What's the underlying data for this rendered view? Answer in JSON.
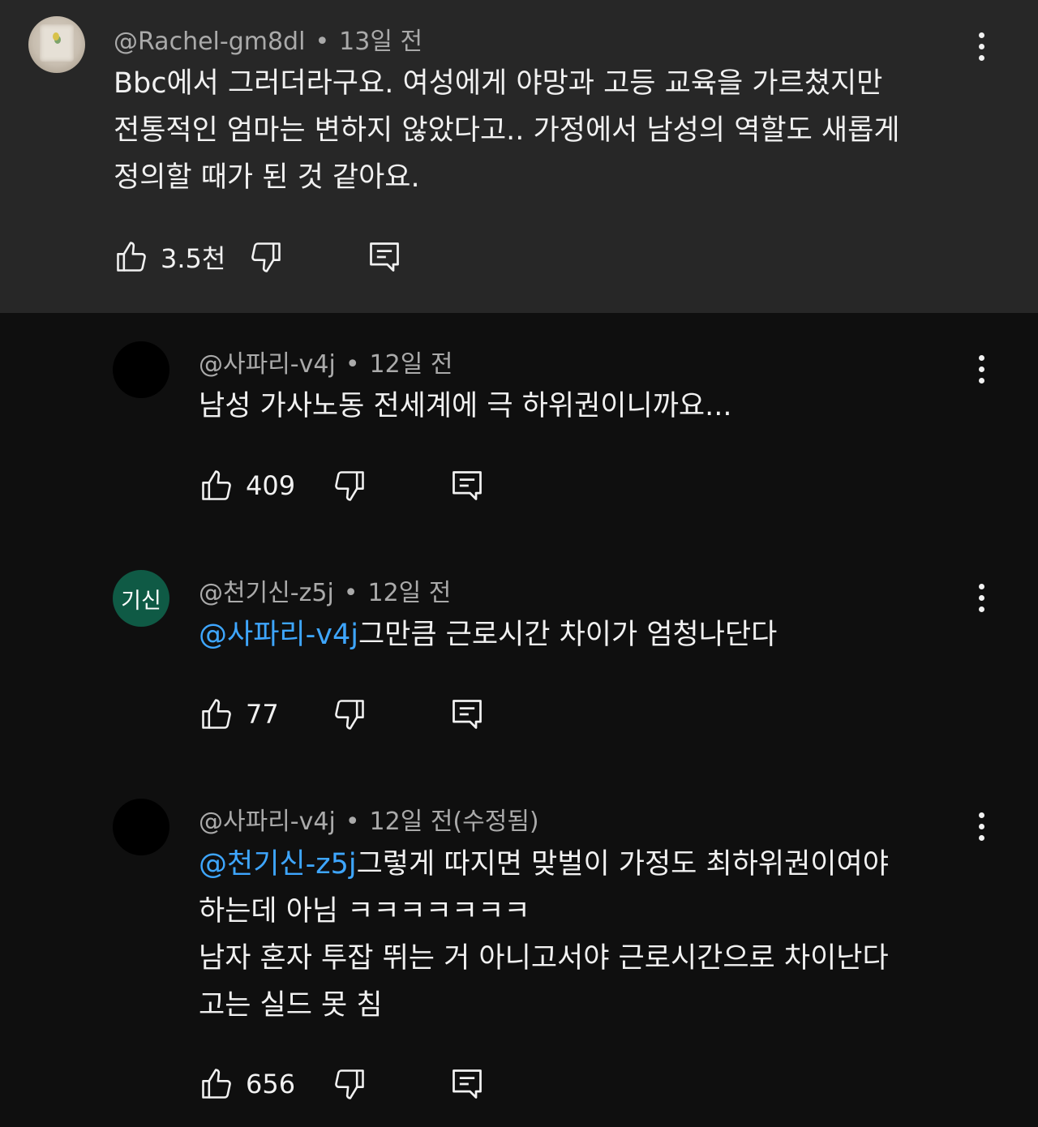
{
  "comments": [
    {
      "author": "@Rachel-gm8dl",
      "separator": "•",
      "time": "13일 전",
      "lines": [
        "Bbc에서 그러더라구요. 여성에게 야망과 고등 교육을 가르쳤지만",
        "전통적인 엄마는 변하지 않았다고.. 가정에서 남성의 역할도 새롭게",
        "정의할 때가 된 것 같아요."
      ],
      "likes": "3.5천"
    },
    {
      "author": "@사파리-v4j",
      "separator": "•",
      "time": "12일 전",
      "lines": [
        "남성 가사노동 전세계에 극 하위권이니까요..."
      ],
      "likes": "409"
    },
    {
      "author": "@천기신-z5j",
      "avatar_text": "기신",
      "separator": "•",
      "time": "12일 전",
      "mention": "@사파리-v4j",
      "lines": [
        "그만큼 근로시간 차이가 엄청나단다"
      ],
      "likes": "77"
    },
    {
      "author": "@사파리-v4j",
      "separator": "•",
      "time": "12일 전(수정됨)",
      "mention": "@천기신-z5j",
      "lines": [
        "그렇게 따지면 맞벌이 가정도 최하위권이여야",
        "하는데 아님 ㅋㅋㅋㅋㅋㅋㅋ",
        "남자 혼자 투잡 뛰는 거 아니고서야 근로시간으로 차이난다",
        "고는 실드 못 침"
      ],
      "likes": "656"
    }
  ],
  "icons": {
    "like": "thumbs-up-icon",
    "dislike": "thumbs-down-icon",
    "reply": "comment-reply-icon",
    "menu": "more-vertical-icon"
  },
  "colors": {
    "background": "#0f0f0f",
    "highlight": "#272727",
    "mention": "#3ea6ff",
    "meta": "#aaaaaa",
    "text": "#f1f1f1",
    "avatar_green": "#0f5a45"
  }
}
